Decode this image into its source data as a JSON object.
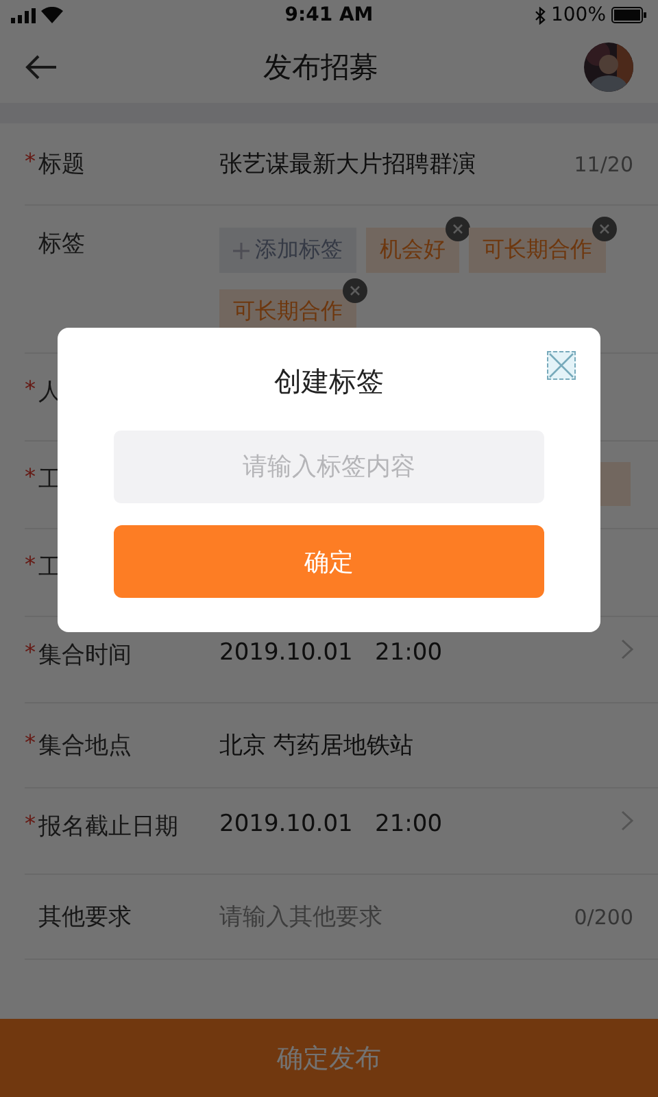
{
  "status_bar": {
    "time": "9:41 AM",
    "battery": "100%"
  },
  "header": {
    "title": "发布招募"
  },
  "fields": [
    {
      "kind": "text",
      "mark": "*",
      "label": "标题",
      "value": "张艺谋最新大片招聘群演",
      "counter": "11/20"
    },
    {
      "kind": "tags",
      "label": "标签",
      "add_label": "添加标签",
      "tags": [
        "机会好",
        "可长期合作",
        "可长期合作"
      ]
    },
    {
      "kind": "hidden",
      "mark": "*",
      "label": "人"
    },
    {
      "kind": "hidden",
      "mark": "*",
      "label": "工",
      "chip": true
    },
    {
      "kind": "hidden",
      "mark": "*",
      "label": "工"
    },
    {
      "kind": "select",
      "mark": "*",
      "label": "集合时间",
      "value": "2019.10.01   21:00"
    },
    {
      "kind": "text",
      "mark": "*",
      "label": "集合地点",
      "value": "北京 芍药居地铁站"
    },
    {
      "kind": "select",
      "mark": "*",
      "label": "报名截止日期",
      "value": "2019.10.01   21:00"
    },
    {
      "kind": "text",
      "label": "其他要求",
      "placeholder": "请输入其他要求",
      "counter": "0/200"
    }
  ],
  "submit": "确定发布",
  "dialog": {
    "title": "创建标签",
    "placeholder": "请输入标签内容",
    "confirm": "确定"
  }
}
